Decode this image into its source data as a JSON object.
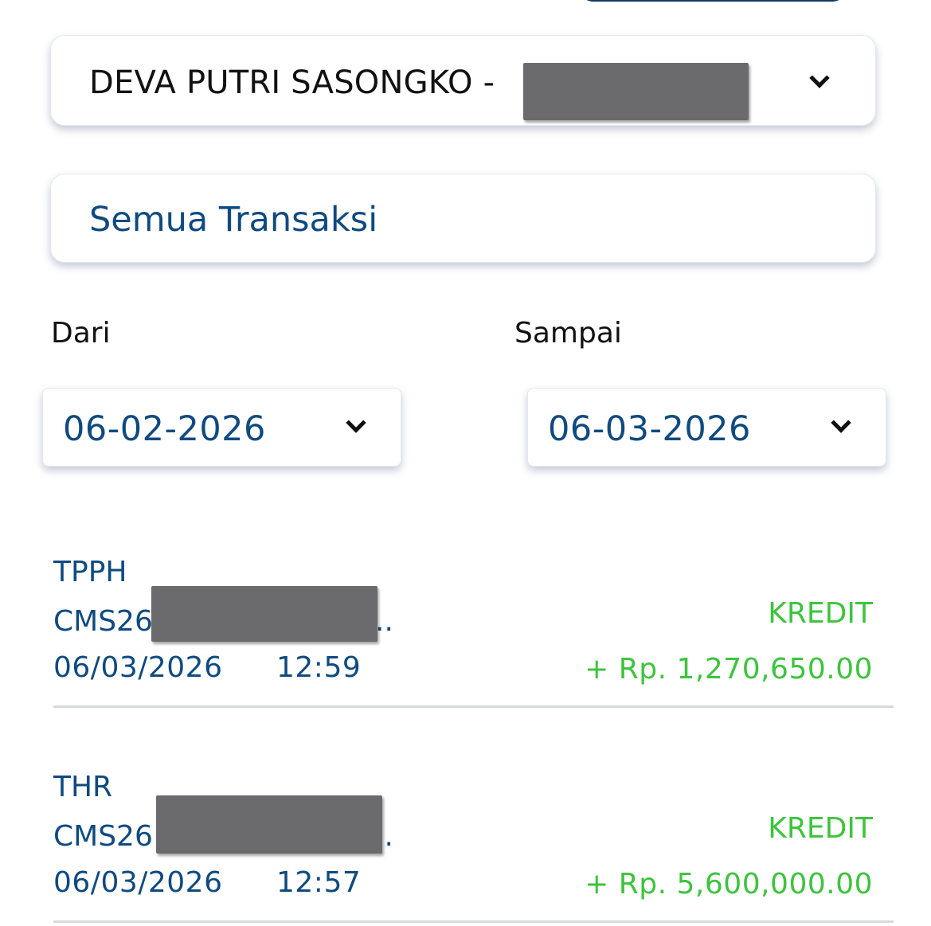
{
  "account": {
    "name": "DEVA PUTRI SASONGKO - ",
    "dropdown_icon": "chevron-down-icon"
  },
  "filter": {
    "label": "Semua Transaksi"
  },
  "date_range": {
    "from_label": "Dari",
    "from_value": "06-02-2026",
    "to_label": "Sampai",
    "to_value": "06-03-2026"
  },
  "transactions": [
    {
      "code": "TPPH",
      "reference": "CMS26",
      "reference_suffix": "..",
      "date": "06/03/2026",
      "time": "12:59",
      "type": "KREDIT",
      "amount": "+ Rp. 1,270,650.00"
    },
    {
      "code": "THR",
      "reference": "CMS26",
      "reference_suffix": "..",
      "date": "06/03/2026",
      "time": "12:57",
      "type": "KREDIT",
      "amount": "+ Rp. 5,600,000.00"
    }
  ],
  "colors": {
    "primary_blue": "#0f4a80",
    "credit_green": "#3dc43d",
    "redaction_gray": "#6b6b6d"
  }
}
